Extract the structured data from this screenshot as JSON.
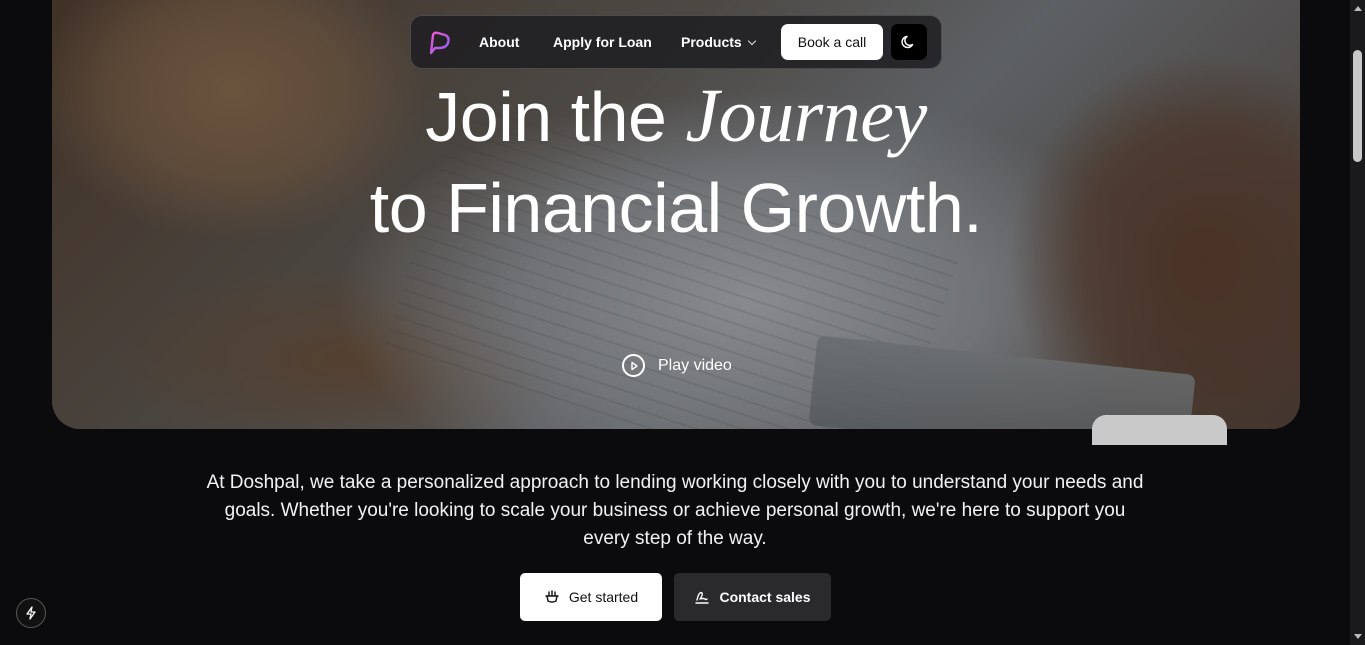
{
  "nav": {
    "about": "About",
    "apply_loan": "Apply for Loan",
    "products": "Products",
    "book_call": "Book a call"
  },
  "hero": {
    "line1_plain": "Join the",
    "line1_script": "Journey",
    "line2": "to Financial Growth.",
    "play_label": "Play video"
  },
  "body": {
    "lede": "At Doshpal, we take a personalized approach to lending working closely with you to understand your needs and goals. Whether you're looking to scale your business or achieve personal growth, we're here to support you every step of the way."
  },
  "cta": {
    "get_started": "Get started",
    "contact_sales": "Contact sales"
  },
  "colors": {
    "background": "#0b0b0d",
    "logo_gradient_start": "#e04fd6",
    "logo_gradient_end": "#8b5cf6"
  },
  "icons": [
    "logo-icon",
    "chevron-down-icon",
    "moon-icon",
    "play-icon",
    "hand-icon",
    "signature-icon",
    "bolt-icon"
  ]
}
